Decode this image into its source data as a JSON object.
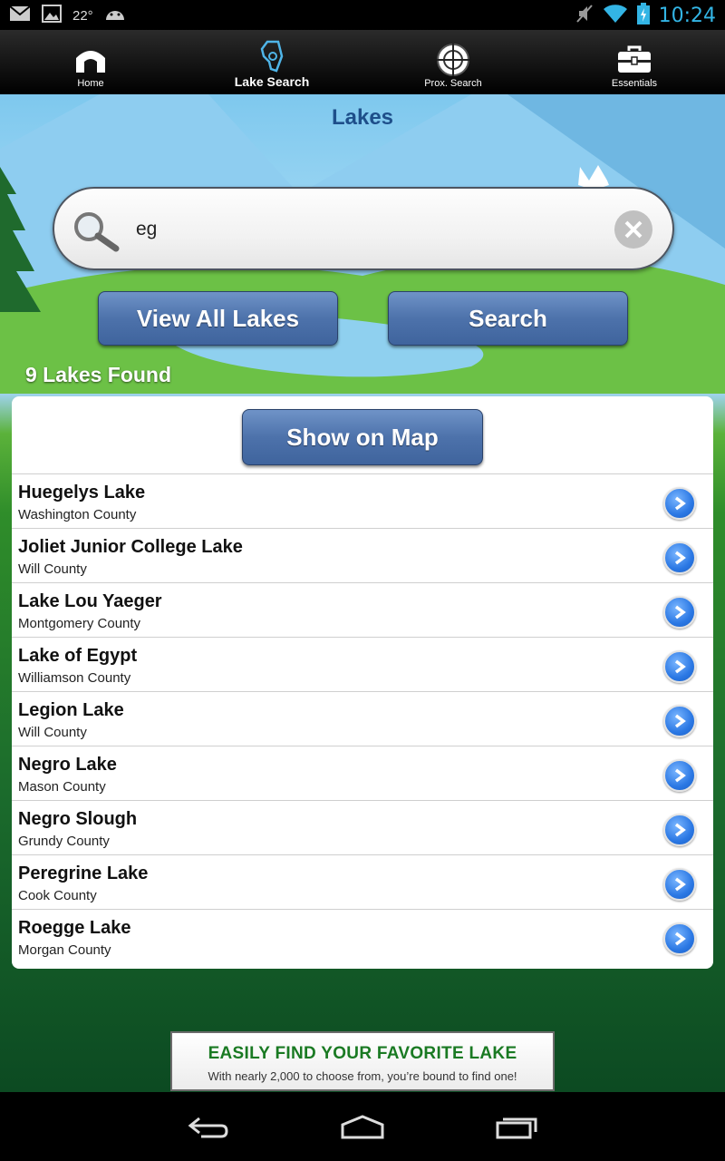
{
  "status_bar": {
    "temperature": "22°",
    "time": "10:24",
    "icons": [
      "gmail-icon",
      "gallery-icon",
      "android-icon",
      "mute-icon",
      "wifi-icon",
      "battery-charging-icon"
    ]
  },
  "nav": {
    "items": [
      {
        "label": "Home",
        "icon": "home-icon",
        "active": false
      },
      {
        "label": "Lake Search",
        "icon": "illinois-map-icon",
        "active": true
      },
      {
        "label": "Prox. Search",
        "icon": "crosshair-icon",
        "active": false
      },
      {
        "label": "Essentials",
        "icon": "toolbox-icon",
        "active": false
      }
    ]
  },
  "page": {
    "title": "Lakes"
  },
  "search": {
    "value": "eg",
    "view_all_label": "View All Lakes",
    "search_label": "Search"
  },
  "results": {
    "count_text": "9 Lakes  Found",
    "show_on_map_label": "Show on Map",
    "lakes": [
      {
        "name": "Huegelys Lake",
        "county": "Washington County"
      },
      {
        "name": "Joliet Junior College Lake",
        "county": "Will County"
      },
      {
        "name": "Lake Lou Yaeger",
        "county": "Montgomery County"
      },
      {
        "name": "Lake of Egypt",
        "county": "Williamson County"
      },
      {
        "name": "Legion Lake",
        "county": "Will County"
      },
      {
        "name": "Negro Lake",
        "county": "Mason County"
      },
      {
        "name": "Negro Slough",
        "county": "Grundy County"
      },
      {
        "name": "Peregrine Lake",
        "county": "Cook County"
      },
      {
        "name": "Roegge Lake",
        "county": "Morgan County"
      }
    ]
  },
  "banner": {
    "title": "EASILY FIND YOUR FAVORITE LAKE",
    "subtitle": "With nearly 2,000 to choose from, you’re bound to find one!"
  },
  "colors": {
    "accent_blue": "#4d72ab",
    "title_blue": "#1e4f8a",
    "status_time": "#33b5e5",
    "banner_green": "#1a7a23"
  }
}
